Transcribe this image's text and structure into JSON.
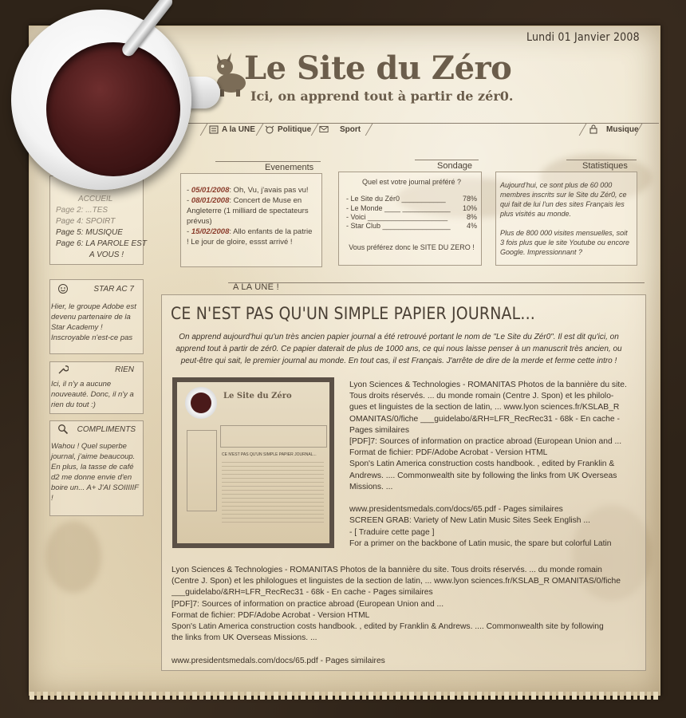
{
  "date": "Lundi 01 Janvier 2008",
  "header": {
    "title": "Le Site du Zéro",
    "slogan": "Ici, on apprend tout à partir de zér0."
  },
  "nav": {
    "items": [
      {
        "label": "A la UNE",
        "icon": "newspaper-icon"
      },
      {
        "label": "Politique",
        "icon": "cow-icon"
      },
      {
        "label": "Sport",
        "icon": "envelope-icon"
      },
      {
        "label": "Musique",
        "icon": "lock-icon"
      }
    ]
  },
  "evenements": {
    "title": "Evenements",
    "items": [
      {
        "date": "05/01/2008",
        "text": ": Oh, Vu, j'avais pas vu!"
      },
      {
        "date": "08/01/2008",
        "text": ": Concert de Muse en Angleterre (1 milliard de spectateurs prévus)"
      },
      {
        "date": "15/02/2008",
        "text": ": Allo enfants de la patrie ! Le jour de gloire, essst arrivé !"
      }
    ]
  },
  "sondage": {
    "title": "Sondage",
    "question": "Quel est votre journal préféré ?",
    "options": [
      {
        "label": "- Le Site du Zér0 ___________",
        "value": "78%"
      },
      {
        "label": "- Le Monde ____ ____________",
        "value": "10%"
      },
      {
        "label": "- Voici ____________________",
        "value": "8%"
      },
      {
        "label": "- Star Club _________________",
        "value": "4%"
      }
    ],
    "conclusion": "Vous préférez donc le SITE DU ZERO !"
  },
  "statistiques": {
    "title": "Statistiques",
    "p1": "Aujourd'hui, ce sont plus de 60 000 membres inscrits sur le Site du Zér0, ce qui fait de lui l'un des sites Français les plus visités au monde.",
    "p2": "Plus de 800 000 visites mensuelles, soit 3 fois plus que le site Youtube ou encore Google. Impressionnant ?"
  },
  "menu": {
    "items": [
      "ACCUEIL",
      "Page 2: ...TES",
      "Page 4: SPOIRT",
      "Page 5: MUSIQUE",
      "Page 6: LA PAROLE EST",
      "A VOUS !"
    ]
  },
  "sidebar": {
    "starac": {
      "title": "STAR AC 7",
      "text": "Hier, le groupe Adobe est devenu partenaire de la Star Academy ! Inscroyable n'est-ce pas"
    },
    "rien": {
      "title": "RIEN",
      "text": "Ici, il n'y a aucune nouveauté. Donc, il n'y a rien du tout :)"
    },
    "compliments": {
      "title": "COMPLIMENTS",
      "text": "Wahou ! Quel superbe journal, j'aime beaucoup. En plus, la tasse de café d2 me donne envie d'en boire un... A+ J'AI SOIIIIIF !"
    }
  },
  "article": {
    "tab": "A LA UNE !",
    "title": "CE N'EST PAS QU'UN SIMPLE PAPIER JOURNAL...",
    "intro": "On apprend aujourd'hui qu'un très ancien papier journal a été retrouvé portant le nom de \"Le Site du Zér0\". Il est dit qu'ici, on apprend tout à partir de zér0. Ce papier daterait de plus de 1000 ans, ce qui nous laisse penser à un manuscrit très ancien, ou peut-être qui sait, le premier journal au monde. En tout cas, il est Français. J'arrête de dire de la merde et ferme cette intro !",
    "right_lines": [
      "Lyon Sciences & Technologies - ROMANITAS Photos de la bannière du site.",
      "Tous droits réservés. ... du monde romain (Centre J. Spon) et les philolo-",
      "gues et linguistes de la section de latin, ... www.lyon sciences.fr/KSLAB_R",
      "OMANITAS/0/fiche ___guidelabo/&RH=LFR_RecRec31 - 68k - En cache -",
      "Pages similaires",
      "[PDF]7: Sources of information on practice abroad (European Union and ...",
      "Format de fichier: PDF/Adobe Acrobat - Version HTML",
      "Spon's Latin America construction costs handbook. , edited by Franklin &",
      "Andrews. .... Commonwealth site by following the links from UK Overseas",
      "Missions. ...",
      "",
      "www.presidentsmedals.com/docs/65.pdf - Pages similaires",
      "SCREEN GRAB: Variety of New Latin Music Sites Seek English ...",
      "- [ Traduire cette page ]",
      "For a primer on the backbone of Latin music, the spare but colorful Latin"
    ],
    "bottom_lines": [
      "Lyon Sciences & Technologies - ROMANITAS Photos de la bannière du site. Tous droits réservés. ... du monde romain",
      "(Centre J. Spon) et les philologues et linguistes de la section de latin, ... www.lyon sciences.fr/KSLAB_R OMANITAS/0/fiche",
      "___guidelabo/&RH=LFR_RecRec31 - 68k - En cache - Pages similaires",
      "[PDF]7: Sources of information on practice abroad (European Union and ...",
      "Format de fichier: PDF/Adobe Acrobat - Version HTML",
      "Spon's Latin America construction costs handbook. , edited by Franklin & Andrews. .... Commonwealth site by following",
      "the links from UK Overseas Missions. ..."
    ],
    "last_line": "www.presidentsmedals.com/docs/65.pdf - Pages similaires",
    "thumb": {
      "title": "Le Site du Zéro",
      "headline": "CE N'EST PAS QU'UN SIMPLE PAPIER JOURNAL..."
    }
  },
  "colors": {
    "ink": "#3b3127",
    "paper": "#ece1c6",
    "accent": "#8a3b2a",
    "coffee": "#4a1a1a"
  }
}
